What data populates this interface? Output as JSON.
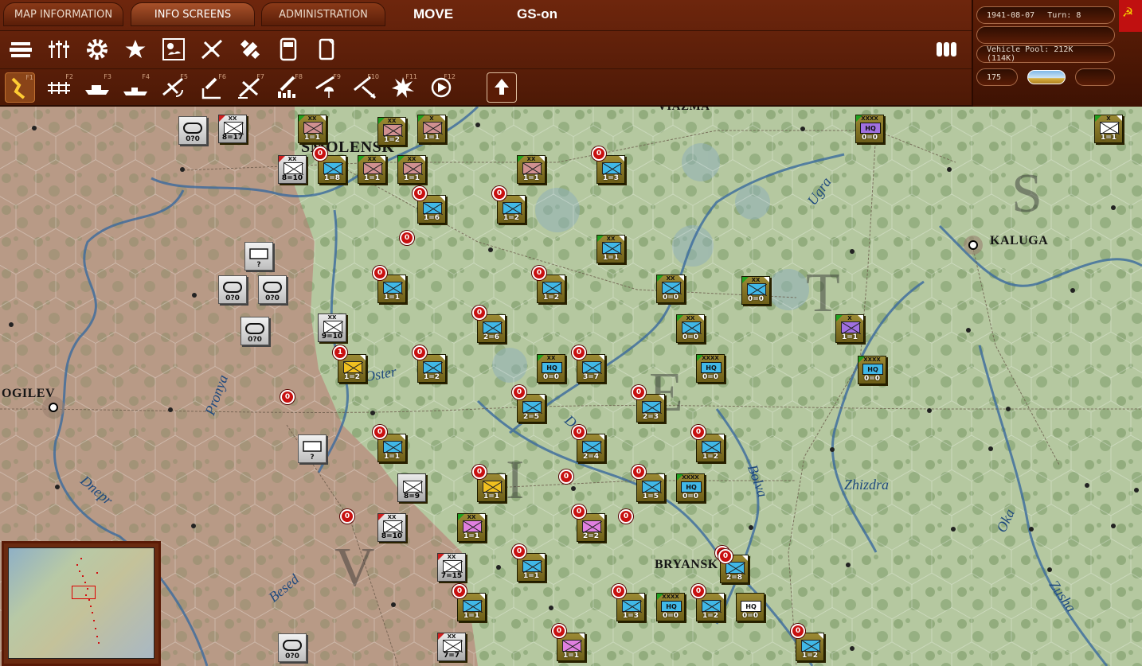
{
  "tabs": [
    {
      "label": "MAP INFORMATION",
      "active": false
    },
    {
      "label": "INFO SCREENS",
      "active": true
    },
    {
      "label": "ADMINISTRATION",
      "active": false
    }
  ],
  "modes": {
    "move": "MOVE",
    "gs": "GS-on"
  },
  "info": {
    "date": "1941-08-07",
    "turn": "Turn: 8",
    "vehicle_pool": "Vehicle Pool: 212K (114K)",
    "value_175": "175"
  },
  "toolbar1_icons": [
    "unit-list-icon",
    "sliders-icon",
    "gear-icon",
    "star-icon",
    "weather-map-icon",
    "air-ops-icon",
    "satellite-icon",
    "supply-icon",
    "report-icon"
  ],
  "toolbar2": [
    {
      "icon": "move-icon",
      "fkey": "F1"
    },
    {
      "icon": "rail-icon",
      "fkey": "F2"
    },
    {
      "icon": "naval-icon",
      "fkey": "F3"
    },
    {
      "icon": "ship-icon",
      "fkey": "F4"
    },
    {
      "icon": "air-recon-icon",
      "fkey": "F5"
    },
    {
      "icon": "artillery-icon",
      "fkey": "F6"
    },
    {
      "icon": "air-attack-icon",
      "fkey": "F7"
    },
    {
      "icon": "bombard-icon",
      "fkey": "F8"
    },
    {
      "icon": "paradrop-icon",
      "fkey": "F9"
    },
    {
      "icon": "interdict-icon",
      "fkey": "F10"
    },
    {
      "icon": "explosion-icon",
      "fkey": "F11"
    },
    {
      "icon": "target-icon",
      "fkey": "F12"
    }
  ],
  "cities": [
    {
      "name": "SMOLENSK"
    },
    {
      "name": "KALUGA"
    },
    {
      "name": "OGILEV"
    },
    {
      "name": "BRYANSK"
    },
    {
      "name": "VIAZMA"
    }
  ],
  "rivers": [
    "Ugra",
    "Oster",
    "Pronya",
    "Dnepr",
    "Besed",
    "Desna",
    "Bolva",
    "Zhizdra",
    "Oka",
    "Zusha"
  ],
  "soviet_units": [
    {
      "val": "1=1",
      "size": "XX",
      "badge": ""
    },
    {
      "val": "1=2",
      "size": "XX",
      "badge": ""
    },
    {
      "val": "1=1",
      "size": "X",
      "badge": ""
    },
    {
      "val": "1=8",
      "size": "",
      "badge": "0"
    },
    {
      "val": "1=1",
      "size": "XX",
      "badge": ""
    },
    {
      "val": "1=1",
      "size": "XX",
      "badge": ""
    },
    {
      "val": "1=6",
      "size": "",
      "badge": "0"
    },
    {
      "val": "1=1",
      "size": "XX",
      "badge": ""
    },
    {
      "val": "1=3",
      "size": "",
      "badge": "0"
    },
    {
      "val": "1=2",
      "size": "",
      "badge": "0"
    },
    {
      "val": "1=1",
      "size": "XX",
      "badge": ""
    },
    {
      "val": "1=1",
      "size": "",
      "badge": "0"
    },
    {
      "val": "1=2",
      "size": "",
      "badge": "0"
    },
    {
      "val": "0=0",
      "size": "XX",
      "badge": ""
    },
    {
      "val": "0=0",
      "size": "XX",
      "badge": ""
    },
    {
      "val": "2=6",
      "size": "",
      "badge": "0"
    },
    {
      "val": "0=0",
      "size": "XX",
      "badge": ""
    },
    {
      "val": "1=1",
      "size": "X",
      "badge": ""
    },
    {
      "val": "1=2",
      "size": "",
      "badge": "1"
    },
    {
      "val": "1=2",
      "size": "",
      "badge": "0"
    },
    {
      "val": "3=7",
      "size": "",
      "badge": "0"
    },
    {
      "val": "2=5",
      "size": "",
      "badge": "0"
    },
    {
      "val": "2=3",
      "size": "",
      "badge": "0"
    },
    {
      "val": "1=1",
      "size": "",
      "badge": "0"
    },
    {
      "val": "2=4",
      "size": "",
      "badge": "0"
    },
    {
      "val": "1=2",
      "size": "",
      "badge": "0"
    },
    {
      "val": "1=1",
      "size": "",
      "badge": "0"
    },
    {
      "val": "1=5",
      "size": "",
      "badge": "0"
    },
    {
      "val": "1=1",
      "size": "XX",
      "badge": ""
    },
    {
      "val": "2=2",
      "size": "",
      "badge": "0"
    },
    {
      "val": "1=1",
      "size": "",
      "badge": "0"
    },
    {
      "val": "2=8",
      "size": "",
      "badge": "0"
    },
    {
      "val": "1=1",
      "size": "",
      "badge": "0"
    },
    {
      "val": "1=3",
      "size": "",
      "badge": "0"
    },
    {
      "val": "1=2",
      "size": "",
      "badge": "0"
    },
    {
      "val": "1=2",
      "size": "",
      "badge": "0"
    },
    {
      "val": "1=1",
      "size": "",
      "badge": "0"
    },
    {
      "val": "1=1",
      "size": "X",
      "badge": ""
    }
  ],
  "hq_units": [
    {
      "label": "HQ",
      "val": "0=0",
      "size": "XXXX"
    },
    {
      "label": "HQ",
      "val": "0=0",
      "size": "XX"
    },
    {
      "label": "HQ",
      "val": "0=0",
      "size": "XXXX"
    },
    {
      "label": "HQ",
      "val": "0=0",
      "size": "XXXX"
    },
    {
      "label": "HQ",
      "val": "0=0",
      "size": "XXXX"
    },
    {
      "label": "HQ",
      "val": "0=0",
      "size": "XXXX"
    },
    {
      "label": "HQ",
      "val": "0=0",
      "size": ""
    }
  ],
  "german_units": [
    {
      "val": "8=17",
      "size": "XX"
    },
    {
      "val": "8=10",
      "size": "XX"
    },
    {
      "val": "9=10",
      "size": "XX"
    },
    {
      "val": "8=9",
      "size": ""
    },
    {
      "val": "8=10",
      "size": "XX"
    },
    {
      "val": "7=15",
      "size": "XX"
    },
    {
      "val": "7=7",
      "size": "XX"
    }
  ],
  "hidden_units": [
    "0?0",
    "?",
    "0?0",
    "0?0",
    "0?0",
    "?",
    "0?0"
  ],
  "lone_badges": [
    "0",
    "0",
    "0",
    "0",
    "0",
    "0"
  ],
  "colors": {
    "chrome": "#5a1e08",
    "soviet_counter": "#8a7a2a",
    "german_counter": "#d8d8d8",
    "soviet_badge": "#c81010",
    "map_green": "#b7c9a0",
    "map_brown": "#b89a86"
  }
}
